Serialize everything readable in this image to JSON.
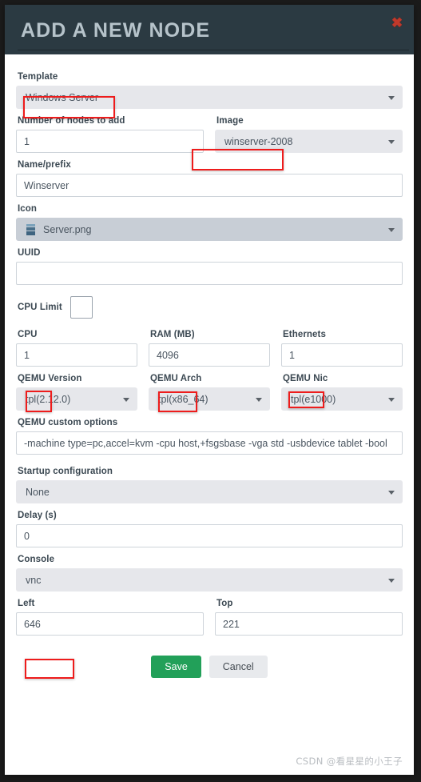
{
  "dialog": {
    "title": "ADD A NEW NODE",
    "close_icon": "close-icon",
    "close_glyph": "✖"
  },
  "form": {
    "template": {
      "label": "Template",
      "value": "Windows Server",
      "highlighted": true
    },
    "number_of_nodes": {
      "label": "Number of nodes to add",
      "value": "1"
    },
    "image": {
      "label": "Image",
      "value": "winserver-2008",
      "highlighted": true
    },
    "name_prefix": {
      "label": "Name/prefix",
      "value": "Winserver"
    },
    "icon": {
      "label": "Icon",
      "value": "Server.png",
      "icon_name": "server-icon"
    },
    "uuid": {
      "label": "UUID",
      "value": ""
    },
    "cpu_limit": {
      "label": "CPU Limit",
      "checked": false
    },
    "cpu": {
      "label": "CPU",
      "value": "1",
      "highlighted": true
    },
    "ram": {
      "label": "RAM (MB)",
      "value": "4096",
      "highlighted": true
    },
    "ethernets": {
      "label": "Ethernets",
      "value": "1",
      "highlighted": true
    },
    "qemu_version": {
      "label": "QEMU Version",
      "value": "tpl(2.12.0)"
    },
    "qemu_arch": {
      "label": "QEMU Arch",
      "value": "tpl(x86_64)"
    },
    "qemu_nic": {
      "label": "QEMU Nic",
      "value": "tpl(e1000)"
    },
    "qemu_custom_options": {
      "label": "QEMU custom options",
      "value": "-machine type=pc,accel=kvm -cpu host,+fsgsbase -vga std -usbdevice tablet -bool"
    },
    "startup_configuration": {
      "label": "Startup configuration",
      "value": "None"
    },
    "delay": {
      "label": "Delay (s)",
      "value": "0"
    },
    "console": {
      "label": "Console",
      "value": "vnc",
      "highlighted": true
    },
    "left": {
      "label": "Left",
      "value": "646"
    },
    "top": {
      "label": "Top",
      "value": "221"
    }
  },
  "buttons": {
    "save": "Save",
    "cancel": "Cancel"
  },
  "watermark": "CSDN @看星星的小王子",
  "colors": {
    "header_bg": "#2b3a42",
    "header_text": "#b6c3ca",
    "save_green": "#22a059",
    "highlight_red": "#ee1c1c",
    "select_bg": "#e6e7eb",
    "icon_select_bg": "#c8ced6"
  }
}
